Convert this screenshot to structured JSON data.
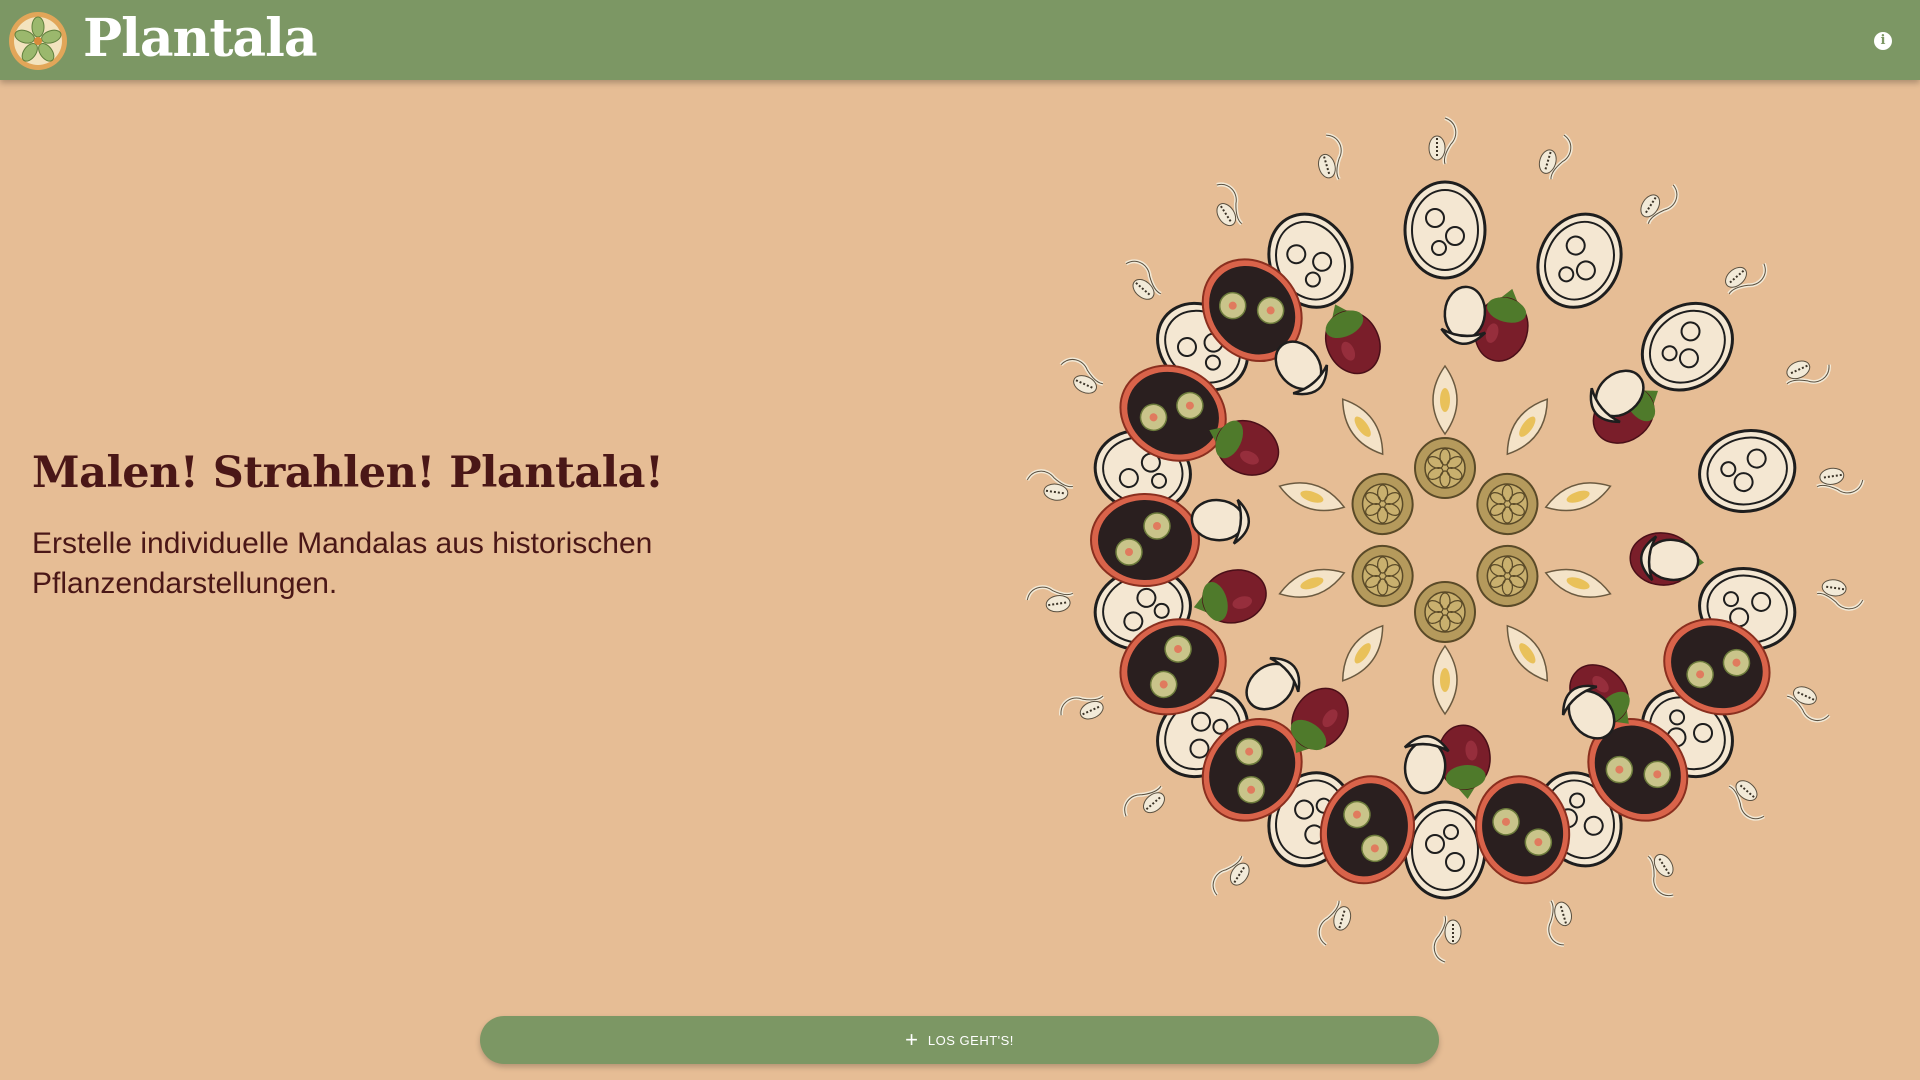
{
  "header": {
    "app_title": "Plantala",
    "logo_icon": "flower-logo-icon",
    "info_icon": "info-icon",
    "info_glyph": "i",
    "colors": {
      "bar": "#7c9764",
      "text": "#ffffff"
    }
  },
  "hero": {
    "title": "Malen! Strahlen! Plantala!",
    "subtitle": "Erstelle individuelle Mandalas aus historischen Pflanzendarstellungen."
  },
  "mandala": {
    "icon": "plant-mandala-illustration",
    "colors": {
      "pod_dark": "#2a1f1f",
      "pod_rim": "#d9634a",
      "berry": "#7a1e2a",
      "leaf": "#4f7a2b",
      "seed": "#f4e3c8",
      "outline": "#1e1e1e"
    }
  },
  "start_button": {
    "icon": "plus-icon",
    "plus_glyph": "+",
    "label": "LOS GEHT'S!"
  },
  "colors": {
    "background": "#e6bd95",
    "heading": "#4a1717",
    "accent": "#7c9764"
  }
}
